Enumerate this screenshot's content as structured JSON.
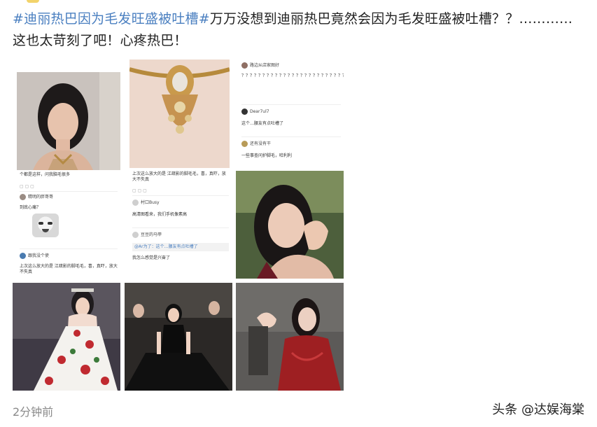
{
  "post": {
    "hashtag": "#迪丽热巴因为毛发旺盛被吐槽#",
    "text_line1": "万万没想到迪丽热巴竟然会因为毛发旺盛被吐槽？？…………",
    "text_line2": "这也太苛刻了吧！心疼热巴！"
  },
  "images": {
    "img1": {
      "caption": "个都是这样，问我脑毛很多",
      "c1_name": "精明的胖哥哥",
      "c1_text": "到底心痛？",
      "c2_name": "跟我没个使",
      "c2_text": "上次这么放大的是 江疏影的脚毛毛，喜，真吓，放大不失真"
    },
    "img2": {
      "caption": "上次这么放大的是 江疏影的脚毛毛，喜，真吓，放大不失真",
      "c1_name": "村口Busy",
      "c1_text": "高清图看来，我们手机像素高",
      "c2_name": "豆豆的马甲",
      "c2_reply": "@Ar为了：这个…腰友有点吐槽了",
      "c2_text": "我怎么感觉是兴奋了"
    },
    "img3": {
      "c1_name": "路边从店家图好",
      "c1_text": "？？？？？？？？？？？？？？？？？？？？？？？？？？？？？？？？？？？？？？？？？？？？？？",
      "c2_name": "Dear7ul7",
      "c2_text": "这个…腰友有点吐槽了",
      "c3_name": "还有没有干",
      "c3_text": "一些事查问护脚毛，哈利利"
    }
  },
  "footer": {
    "time": "2分钟前",
    "source": "头条 @达娱海棠"
  }
}
